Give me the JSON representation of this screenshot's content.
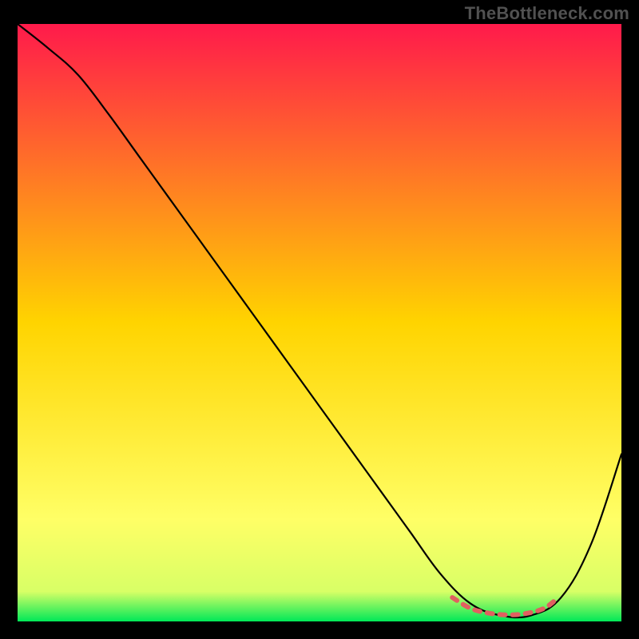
{
  "watermark": "TheBottleneck.com",
  "colors": {
    "curve_black": "#000000",
    "highlight_red": "#e06060",
    "gradient_stops": [
      {
        "offset": "0%",
        "color": "#ff1a4b"
      },
      {
        "offset": "50%",
        "color": "#ffd400"
      },
      {
        "offset": "83%",
        "color": "#ffff66"
      },
      {
        "offset": "95%",
        "color": "#d8ff66"
      },
      {
        "offset": "100%",
        "color": "#00e858"
      }
    ]
  },
  "chart_data": {
    "type": "line",
    "title": "",
    "xlabel": "",
    "ylabel": "",
    "xlim": [
      0,
      100
    ],
    "ylim": [
      0,
      100
    ],
    "grid": false,
    "legend": false,
    "annotations": [],
    "series": [
      {
        "name": "bottleneck-curve",
        "x": [
          0,
          5,
          10,
          15,
          20,
          25,
          30,
          35,
          40,
          45,
          50,
          55,
          60,
          65,
          70,
          75,
          80,
          85,
          90,
          95,
          100
        ],
        "y": [
          100,
          96,
          91.5,
          85,
          78,
          71,
          64,
          57,
          50,
          43,
          36,
          29,
          22,
          15,
          8,
          3,
          1,
          1,
          4,
          13,
          28
        ],
        "color": "curve_black",
        "width": 2.2
      }
    ],
    "highlight": {
      "name": "optimal-range",
      "x": [
        72,
        75,
        78,
        81,
        84,
        87,
        89
      ],
      "y": [
        4.0,
        2.2,
        1.4,
        1.1,
        1.3,
        2.1,
        3.5
      ],
      "color": "highlight_red",
      "width": 6,
      "dash": [
        7,
        9
      ]
    }
  }
}
